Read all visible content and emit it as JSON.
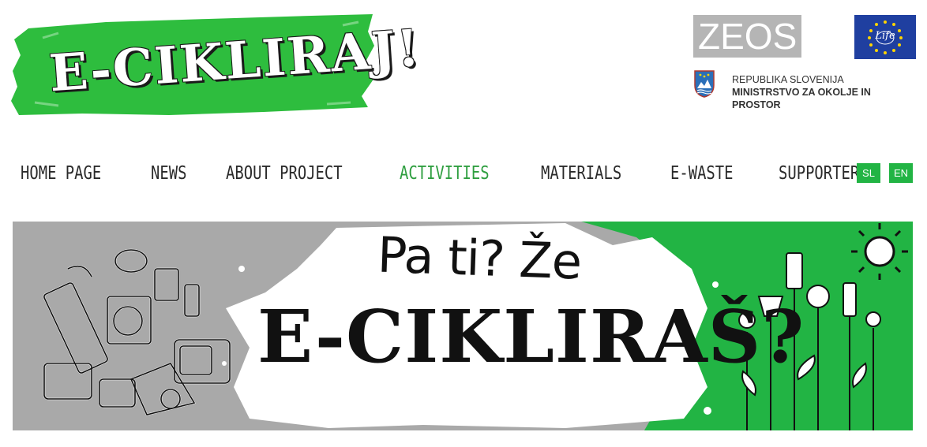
{
  "header": {
    "logo_text": "E-CIKLIRAJ!",
    "logo_color": "#2ebd3e",
    "partners": {
      "zeos_letters": [
        "Z",
        "E",
        "O",
        "S"
      ],
      "life_label": "Life",
      "ministry_line1": "REPUBLIKA SLOVENIJA",
      "ministry_line2": "MINISTRSTVO ZA OKOLJE IN PROSTOR"
    }
  },
  "nav": {
    "items": [
      {
        "label": "HOME PAGE",
        "active": false
      },
      {
        "label": "NEWS",
        "active": false
      },
      {
        "label": "ABOUT PROJECT",
        "active": false
      },
      {
        "label": "ACTIVITIES",
        "active": true
      },
      {
        "label": "MATERIALS",
        "active": false
      },
      {
        "label": "E-WASTE",
        "active": false
      },
      {
        "label": "SUPPORTERS",
        "active": false
      }
    ],
    "active_color": "#2e9e3f",
    "languages": [
      "SL",
      "EN"
    ],
    "language_button_color": "#22b444"
  },
  "banner": {
    "tagline": "Pa ti? Že",
    "headline": "E-CIKLIRAŠ?",
    "colors": {
      "grey": "#a9a9a9",
      "green": "#22b444",
      "paper": "#ffffff"
    }
  }
}
